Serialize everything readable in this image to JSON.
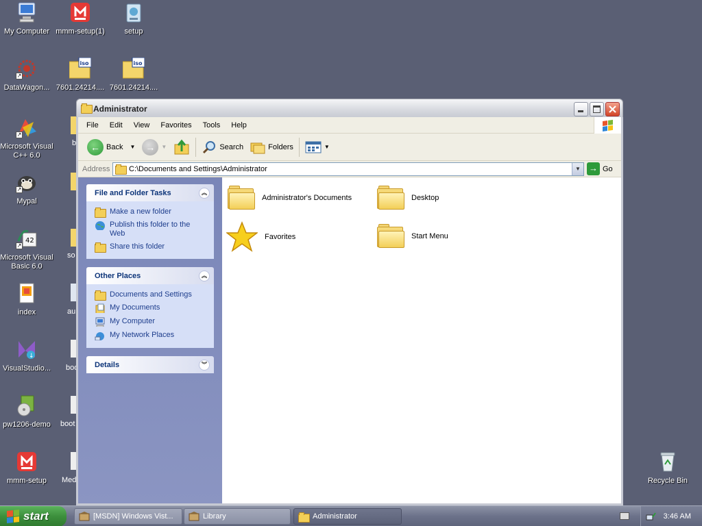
{
  "desktop": {
    "icons": [
      {
        "label": "My Computer",
        "icon": "my-computer-icon"
      },
      {
        "label": "mmm-setup(1)",
        "icon": "installer-icon"
      },
      {
        "label": "setup",
        "icon": "setup-icon"
      },
      {
        "label": "DataWagon...",
        "icon": "datawagon-icon"
      },
      {
        "label": "7601.24214....",
        "icon": "iso-file-icon"
      },
      {
        "label": "7601.24214....",
        "icon": "iso-file-icon"
      },
      {
        "label": "Microsoft Visual C++ 6.0",
        "icon": "visual-cpp-icon"
      },
      {
        "label": "Mypal",
        "icon": "mypal-icon"
      },
      {
        "label": "Microsoft Visual Basic 6.0",
        "icon": "visual-basic-icon"
      },
      {
        "label": "index",
        "icon": "html-file-icon"
      },
      {
        "label": "VisualStudio...",
        "icon": "visual-studio-icon"
      },
      {
        "label": "pw1206-demo",
        "icon": "cd-installer-icon"
      },
      {
        "label": "mmm-setup",
        "icon": "installer-icon"
      },
      {
        "label": "Recycle Bin",
        "icon": "recycle-bin-icon"
      }
    ],
    "partial_labels": [
      "b",
      "so",
      "au",
      "boo",
      "boot",
      "Med"
    ]
  },
  "window": {
    "title": "Administrator",
    "menu": [
      "File",
      "Edit",
      "View",
      "Favorites",
      "Tools",
      "Help"
    ],
    "toolbar": {
      "back": "Back",
      "search": "Search",
      "folders": "Folders"
    },
    "address": {
      "label": "Address",
      "value": "C:\\Documents and Settings\\Administrator",
      "go": "Go"
    },
    "tasks": {
      "file_folder": {
        "title": "File and Folder Tasks",
        "items": [
          "Make a new folder",
          "Publish this folder to the Web",
          "Share this folder"
        ]
      },
      "other_places": {
        "title": "Other Places",
        "items": [
          "Documents and Settings",
          "My Documents",
          "My Computer",
          "My Network Places"
        ]
      },
      "details": {
        "title": "Details"
      }
    },
    "files": [
      {
        "name": "Administrator's Documents",
        "icon": "folder-icon"
      },
      {
        "name": "Desktop",
        "icon": "folder-icon"
      },
      {
        "name": "Favorites",
        "icon": "star-icon"
      },
      {
        "name": "Start Menu",
        "icon": "folder-icon"
      }
    ]
  },
  "taskbar": {
    "start": "start",
    "tasks": [
      {
        "label": "[MSDN] Windows Vist...",
        "active": false
      },
      {
        "label": "Library",
        "active": false
      },
      {
        "label": "Administrator",
        "active": true
      }
    ],
    "clock": "3:46 AM"
  }
}
